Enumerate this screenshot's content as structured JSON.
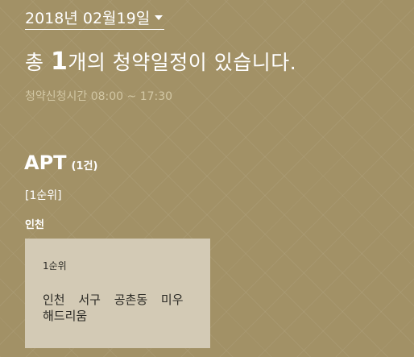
{
  "date_selector": {
    "label": "2018년 02월19일"
  },
  "headline": {
    "prefix": "총 ",
    "count": "1",
    "suffix": "개의 청약일정이 있습니다."
  },
  "hours": "청약신청시간 08:00 ~ 17:30",
  "section": {
    "title": "APT",
    "count": "(1건)",
    "rank": "[1순위]",
    "region": "인천"
  },
  "listing": {
    "rank": "1순위",
    "name": "인천 서구 공촌동 미우해드리움"
  }
}
